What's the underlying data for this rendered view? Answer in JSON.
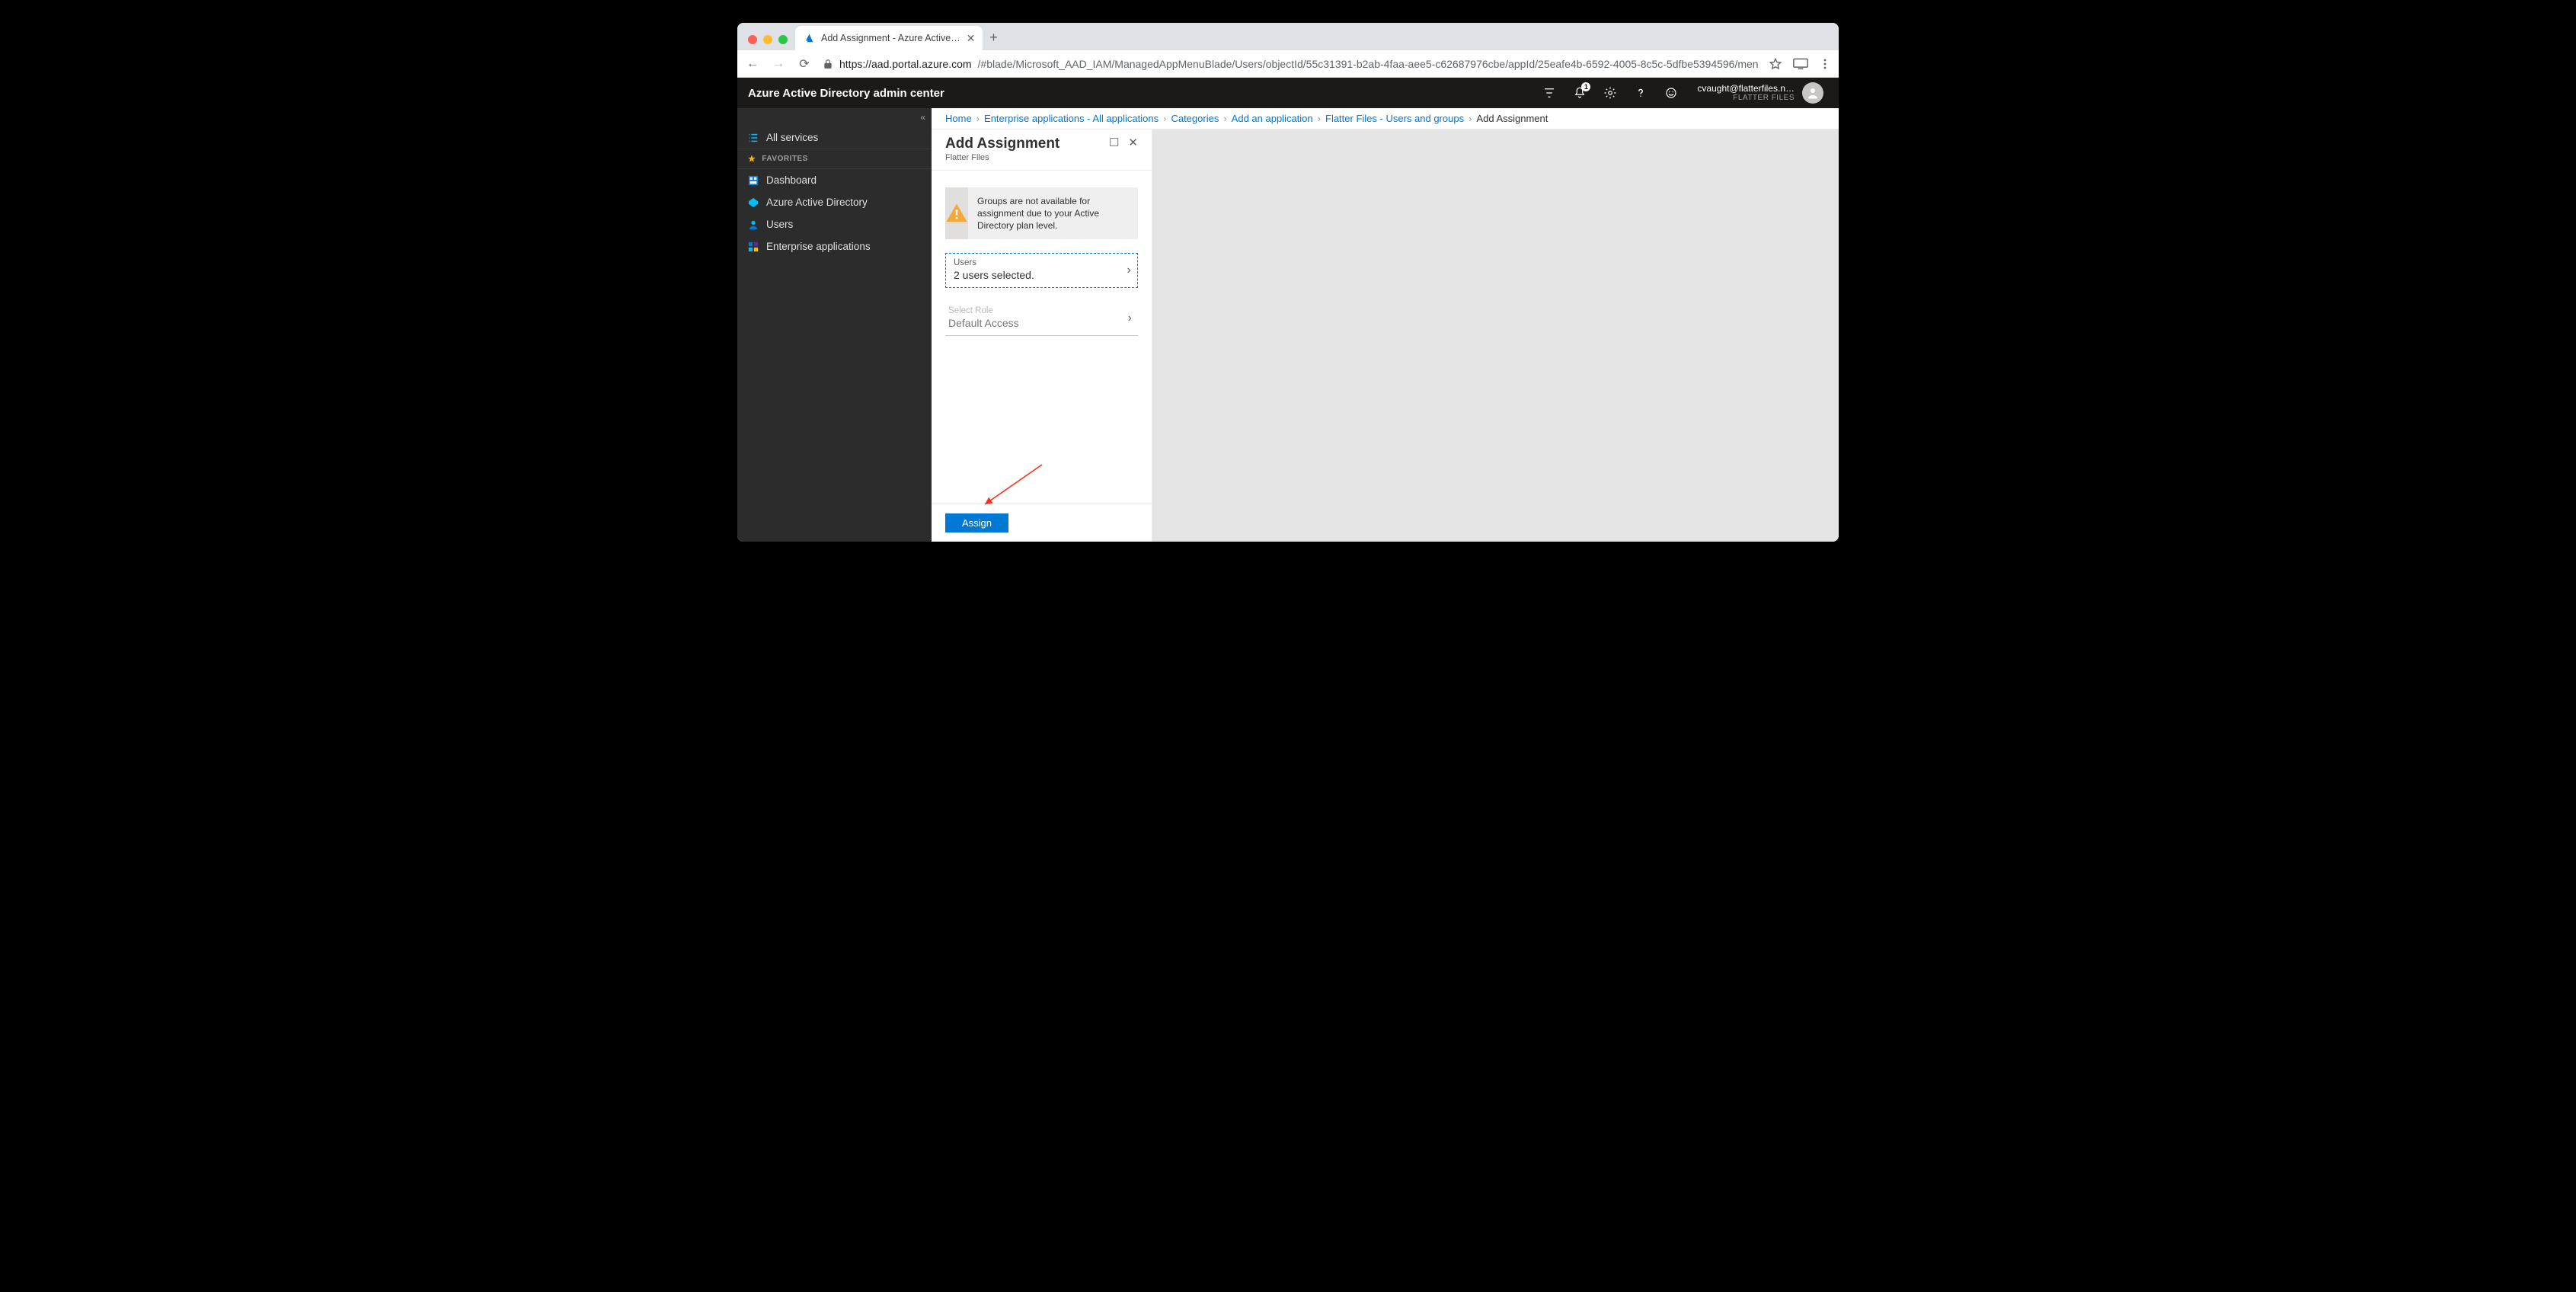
{
  "browser": {
    "tab_title": "Add Assignment - Azure Active…",
    "url_host": "https://aad.portal.azure.com",
    "url_path": "/#blade/Microsoft_AAD_IAM/ManagedAppMenuBlade/Users/objectId/55c31391-b2ab-4faa-aee5-c62687976cbe/appId/25eafe4b-6592-4005-8c5c-5dfbe5394596/menuIte…"
  },
  "azure": {
    "portal_title": "Azure Active Directory admin center",
    "notif_count": "1",
    "account_email": "cvaught@flatterfiles.n…",
    "account_org": "FLATTER FILES"
  },
  "sidebar": {
    "all_services": "All services",
    "favorites_label": "FAVORITES",
    "items": {
      "dashboard": "Dashboard",
      "aad": "Azure Active Directory",
      "users": "Users",
      "ent_apps": "Enterprise applications"
    }
  },
  "breadcrumbs": {
    "home": "Home",
    "ent_apps": "Enterprise applications - All applications",
    "categories": "Categories",
    "add_app": "Add an application",
    "flatter": "Flatter Files - Users and groups",
    "current": "Add Assignment"
  },
  "blade": {
    "title": "Add Assignment",
    "subtitle": "Flatter Files",
    "warning": "Groups are not available for assignment due to your Active Directory plan level.",
    "users_label": "Users",
    "users_value": "2 users selected.",
    "role_label": "Select Role",
    "role_value": "Default Access",
    "assign": "Assign"
  },
  "colors": {
    "mac_red": "#ff5f57",
    "mac_yellow": "#febc2e",
    "mac_green": "#28c840"
  }
}
